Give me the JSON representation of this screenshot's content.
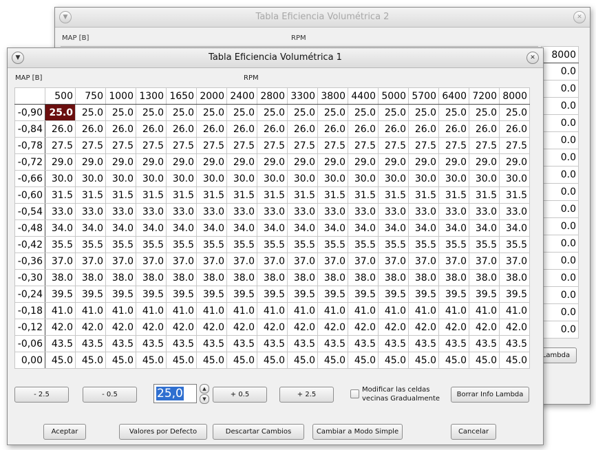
{
  "back_window": {
    "title": "Tabla Eficiencia Volumétrica 2",
    "map_label": "MAP [B]",
    "rpm_label": "RPM",
    "col_header": "8000",
    "col_values": [
      "0.0",
      "0.0",
      "0.0",
      "0.0",
      "0.0",
      "0.0",
      "0.0",
      "0.0",
      "0.0",
      "0.0",
      "0.0",
      "0.0",
      "0.0",
      "0.0",
      "0.0",
      "0.0"
    ],
    "lambda_button": "Lambda"
  },
  "front_window": {
    "title": "Tabla Eficiencia Volumétrica 1",
    "map_label": "MAP [B]",
    "rpm_label": "RPM",
    "rpm_headers": [
      "500",
      "750",
      "1000",
      "1300",
      "1650",
      "2000",
      "2400",
      "2800",
      "3300",
      "3800",
      "4400",
      "5000",
      "5700",
      "6400",
      "7200",
      "8000"
    ],
    "rows": [
      {
        "map": "-0,90",
        "value": "25.0"
      },
      {
        "map": "-0,84",
        "value": "26.0"
      },
      {
        "map": "-0,78",
        "value": "27.5"
      },
      {
        "map": "-0,72",
        "value": "29.0"
      },
      {
        "map": "-0,66",
        "value": "30.0"
      },
      {
        "map": "-0,60",
        "value": "31.5"
      },
      {
        "map": "-0,54",
        "value": "33.0"
      },
      {
        "map": "-0,48",
        "value": "34.0"
      },
      {
        "map": "-0,42",
        "value": "35.5"
      },
      {
        "map": "-0,36",
        "value": "37.0"
      },
      {
        "map": "-0,30",
        "value": "38.0"
      },
      {
        "map": "-0,24",
        "value": "39.5"
      },
      {
        "map": "-0,18",
        "value": "41.0"
      },
      {
        "map": "-0,12",
        "value": "42.0"
      },
      {
        "map": "-0,06",
        "value": "43.5"
      },
      {
        "map": "0,00",
        "value": "45.0"
      }
    ],
    "selected_cell_color": "#6b0f0f",
    "adjust_buttons": {
      "minus_big": "- 2.5",
      "minus_small": "- 0.5",
      "plus_small": "+ 0.5",
      "plus_big": "+ 2.5"
    },
    "edit_value": "25,0",
    "checkbox_label": "Modificar las celdas vecinas Gradualmente",
    "clear_lambda_button": "Borrar Info Lambda",
    "footer": {
      "accept": "Aceptar",
      "defaults": "Valores por Defecto",
      "discard": "Descartar Cambios",
      "simple_mode": "Cambiar a Modo Simple",
      "cancel": "Cancelar"
    }
  }
}
